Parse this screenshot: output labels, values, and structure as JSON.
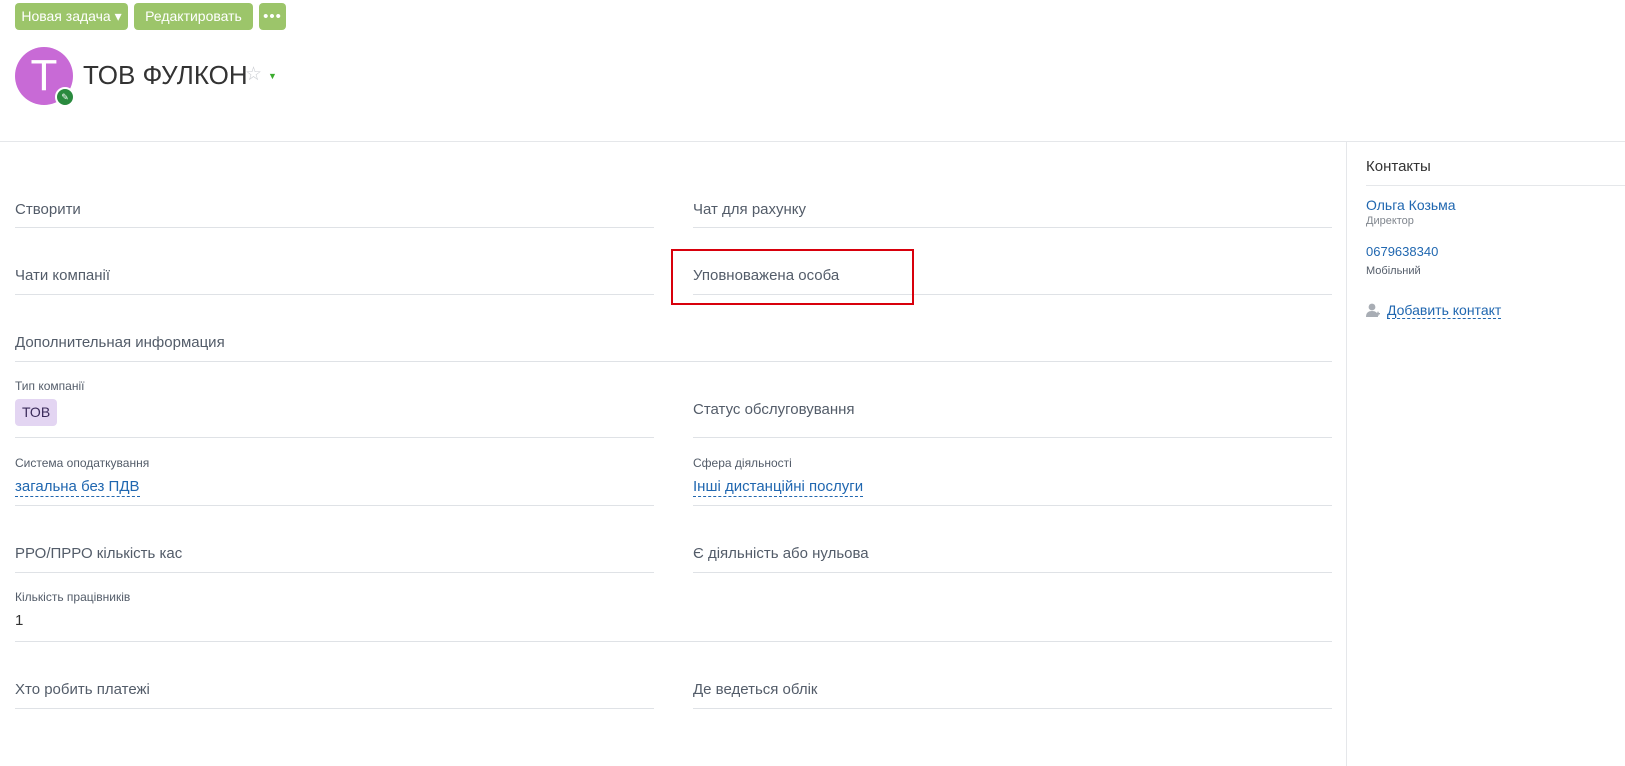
{
  "toolbar": {
    "new_task_label": "Новая задача ▾",
    "edit_label": "Редактировать",
    "more_label": "•••"
  },
  "header": {
    "avatar_letter": "T",
    "title": "ТОВ ФУЛКОН",
    "star_icon": "☆",
    "dropdown_icon": "▼"
  },
  "fields": {
    "create": "Створити",
    "invoice_chat": "Чат для рахунку",
    "company_chats": "Чати компанії",
    "authorized_person": "Уповноважена особа",
    "additional_info": "Дополнительная информация",
    "company_type": {
      "label": "Тип компанії",
      "value": "ТОВ"
    },
    "service_status": "Статус обслуговування",
    "tax_system": {
      "label": "Система оподаткування",
      "value": "загальна без ПДВ"
    },
    "activity_sphere": {
      "label": "Сфера діяльності",
      "value": "Інші дистанційні послуги"
    },
    "cash_registers": "РРО/ПРРО кількість кас",
    "activity_or_zero": "Є діяльність або нульова",
    "employees": {
      "label": "Кількість працівників",
      "value": "1"
    },
    "who_pays": "Хто робить платежі",
    "accounting_place": "Де ведеться облік"
  },
  "sidebar": {
    "heading": "Контакты",
    "contact": {
      "name": "Ольга Козьма",
      "position": "Директор",
      "phone": "0679638340",
      "phone_type": "Мобільний"
    },
    "add_contact_label": "Добавить контакт"
  },
  "colors": {
    "button_green": "#9cc56a",
    "avatar": "#c86ad6",
    "link": "#2067b0",
    "highlight": "#d8000c",
    "tag": "#e3d5f2"
  }
}
